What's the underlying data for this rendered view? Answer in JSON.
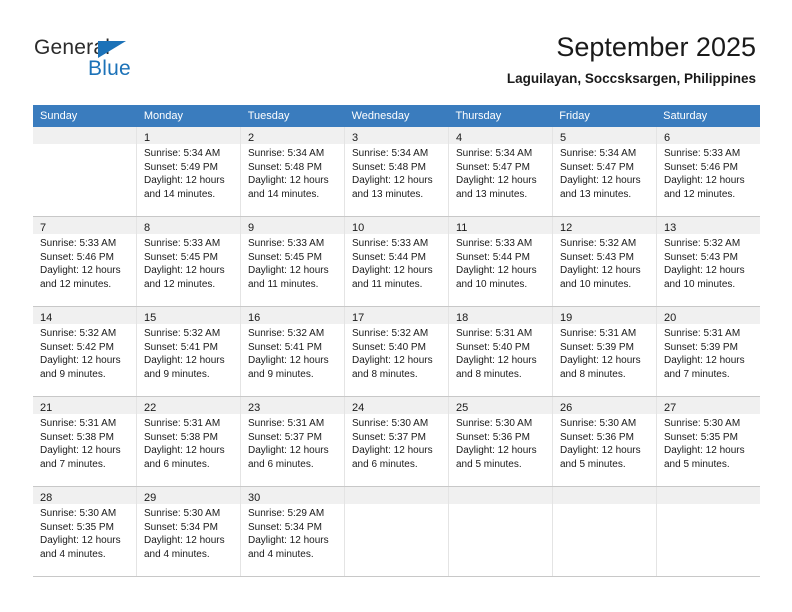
{
  "logo": {
    "word_top": "General",
    "word_bottom": "Blue",
    "triangle_color": "#1c72b8",
    "text_color": "#2b2b2b"
  },
  "header": {
    "title": "September 2025",
    "subtitle": "Laguilayan, Soccsksargen, Philippines"
  },
  "theme": {
    "header_row_bg": "#3a7cbe",
    "header_row_text": "#ffffff",
    "daynum_band_bg": "#f0f0f0",
    "grid_line": "#c8c8c8"
  },
  "weekdays": [
    "Sunday",
    "Monday",
    "Tuesday",
    "Wednesday",
    "Thursday",
    "Friday",
    "Saturday"
  ],
  "weeks": [
    [
      {
        "day": "",
        "sunrise": "",
        "sunset": "",
        "daylight": "",
        "empty": true
      },
      {
        "day": "1",
        "sunrise": "Sunrise: 5:34 AM",
        "sunset": "Sunset: 5:49 PM",
        "daylight": "Daylight: 12 hours and 14 minutes."
      },
      {
        "day": "2",
        "sunrise": "Sunrise: 5:34 AM",
        "sunset": "Sunset: 5:48 PM",
        "daylight": "Daylight: 12 hours and 14 minutes."
      },
      {
        "day": "3",
        "sunrise": "Sunrise: 5:34 AM",
        "sunset": "Sunset: 5:48 PM",
        "daylight": "Daylight: 12 hours and 13 minutes."
      },
      {
        "day": "4",
        "sunrise": "Sunrise: 5:34 AM",
        "sunset": "Sunset: 5:47 PM",
        "daylight": "Daylight: 12 hours and 13 minutes."
      },
      {
        "day": "5",
        "sunrise": "Sunrise: 5:34 AM",
        "sunset": "Sunset: 5:47 PM",
        "daylight": "Daylight: 12 hours and 13 minutes."
      },
      {
        "day": "6",
        "sunrise": "Sunrise: 5:33 AM",
        "sunset": "Sunset: 5:46 PM",
        "daylight": "Daylight: 12 hours and 12 minutes."
      }
    ],
    [
      {
        "day": "7",
        "sunrise": "Sunrise: 5:33 AM",
        "sunset": "Sunset: 5:46 PM",
        "daylight": "Daylight: 12 hours and 12 minutes."
      },
      {
        "day": "8",
        "sunrise": "Sunrise: 5:33 AM",
        "sunset": "Sunset: 5:45 PM",
        "daylight": "Daylight: 12 hours and 12 minutes."
      },
      {
        "day": "9",
        "sunrise": "Sunrise: 5:33 AM",
        "sunset": "Sunset: 5:45 PM",
        "daylight": "Daylight: 12 hours and 11 minutes."
      },
      {
        "day": "10",
        "sunrise": "Sunrise: 5:33 AM",
        "sunset": "Sunset: 5:44 PM",
        "daylight": "Daylight: 12 hours and 11 minutes."
      },
      {
        "day": "11",
        "sunrise": "Sunrise: 5:33 AM",
        "sunset": "Sunset: 5:44 PM",
        "daylight": "Daylight: 12 hours and 10 minutes."
      },
      {
        "day": "12",
        "sunrise": "Sunrise: 5:32 AM",
        "sunset": "Sunset: 5:43 PM",
        "daylight": "Daylight: 12 hours and 10 minutes."
      },
      {
        "day": "13",
        "sunrise": "Sunrise: 5:32 AM",
        "sunset": "Sunset: 5:43 PM",
        "daylight": "Daylight: 12 hours and 10 minutes."
      }
    ],
    [
      {
        "day": "14",
        "sunrise": "Sunrise: 5:32 AM",
        "sunset": "Sunset: 5:42 PM",
        "daylight": "Daylight: 12 hours and 9 minutes."
      },
      {
        "day": "15",
        "sunrise": "Sunrise: 5:32 AM",
        "sunset": "Sunset: 5:41 PM",
        "daylight": "Daylight: 12 hours and 9 minutes."
      },
      {
        "day": "16",
        "sunrise": "Sunrise: 5:32 AM",
        "sunset": "Sunset: 5:41 PM",
        "daylight": "Daylight: 12 hours and 9 minutes."
      },
      {
        "day": "17",
        "sunrise": "Sunrise: 5:32 AM",
        "sunset": "Sunset: 5:40 PM",
        "daylight": "Daylight: 12 hours and 8 minutes."
      },
      {
        "day": "18",
        "sunrise": "Sunrise: 5:31 AM",
        "sunset": "Sunset: 5:40 PM",
        "daylight": "Daylight: 12 hours and 8 minutes."
      },
      {
        "day": "19",
        "sunrise": "Sunrise: 5:31 AM",
        "sunset": "Sunset: 5:39 PM",
        "daylight": "Daylight: 12 hours and 8 minutes."
      },
      {
        "day": "20",
        "sunrise": "Sunrise: 5:31 AM",
        "sunset": "Sunset: 5:39 PM",
        "daylight": "Daylight: 12 hours and 7 minutes."
      }
    ],
    [
      {
        "day": "21",
        "sunrise": "Sunrise: 5:31 AM",
        "sunset": "Sunset: 5:38 PM",
        "daylight": "Daylight: 12 hours and 7 minutes."
      },
      {
        "day": "22",
        "sunrise": "Sunrise: 5:31 AM",
        "sunset": "Sunset: 5:38 PM",
        "daylight": "Daylight: 12 hours and 6 minutes."
      },
      {
        "day": "23",
        "sunrise": "Sunrise: 5:31 AM",
        "sunset": "Sunset: 5:37 PM",
        "daylight": "Daylight: 12 hours and 6 minutes."
      },
      {
        "day": "24",
        "sunrise": "Sunrise: 5:30 AM",
        "sunset": "Sunset: 5:37 PM",
        "daylight": "Daylight: 12 hours and 6 minutes."
      },
      {
        "day": "25",
        "sunrise": "Sunrise: 5:30 AM",
        "sunset": "Sunset: 5:36 PM",
        "daylight": "Daylight: 12 hours and 5 minutes."
      },
      {
        "day": "26",
        "sunrise": "Sunrise: 5:30 AM",
        "sunset": "Sunset: 5:36 PM",
        "daylight": "Daylight: 12 hours and 5 minutes."
      },
      {
        "day": "27",
        "sunrise": "Sunrise: 5:30 AM",
        "sunset": "Sunset: 5:35 PM",
        "daylight": "Daylight: 12 hours and 5 minutes."
      }
    ],
    [
      {
        "day": "28",
        "sunrise": "Sunrise: 5:30 AM",
        "sunset": "Sunset: 5:35 PM",
        "daylight": "Daylight: 12 hours and 4 minutes."
      },
      {
        "day": "29",
        "sunrise": "Sunrise: 5:30 AM",
        "sunset": "Sunset: 5:34 PM",
        "daylight": "Daylight: 12 hours and 4 minutes."
      },
      {
        "day": "30",
        "sunrise": "Sunrise: 5:29 AM",
        "sunset": "Sunset: 5:34 PM",
        "daylight": "Daylight: 12 hours and 4 minutes."
      },
      {
        "day": "",
        "sunrise": "",
        "sunset": "",
        "daylight": "",
        "empty": true
      },
      {
        "day": "",
        "sunrise": "",
        "sunset": "",
        "daylight": "",
        "empty": true
      },
      {
        "day": "",
        "sunrise": "",
        "sunset": "",
        "daylight": "",
        "empty": true
      },
      {
        "day": "",
        "sunrise": "",
        "sunset": "",
        "daylight": "",
        "empty": true
      }
    ]
  ]
}
